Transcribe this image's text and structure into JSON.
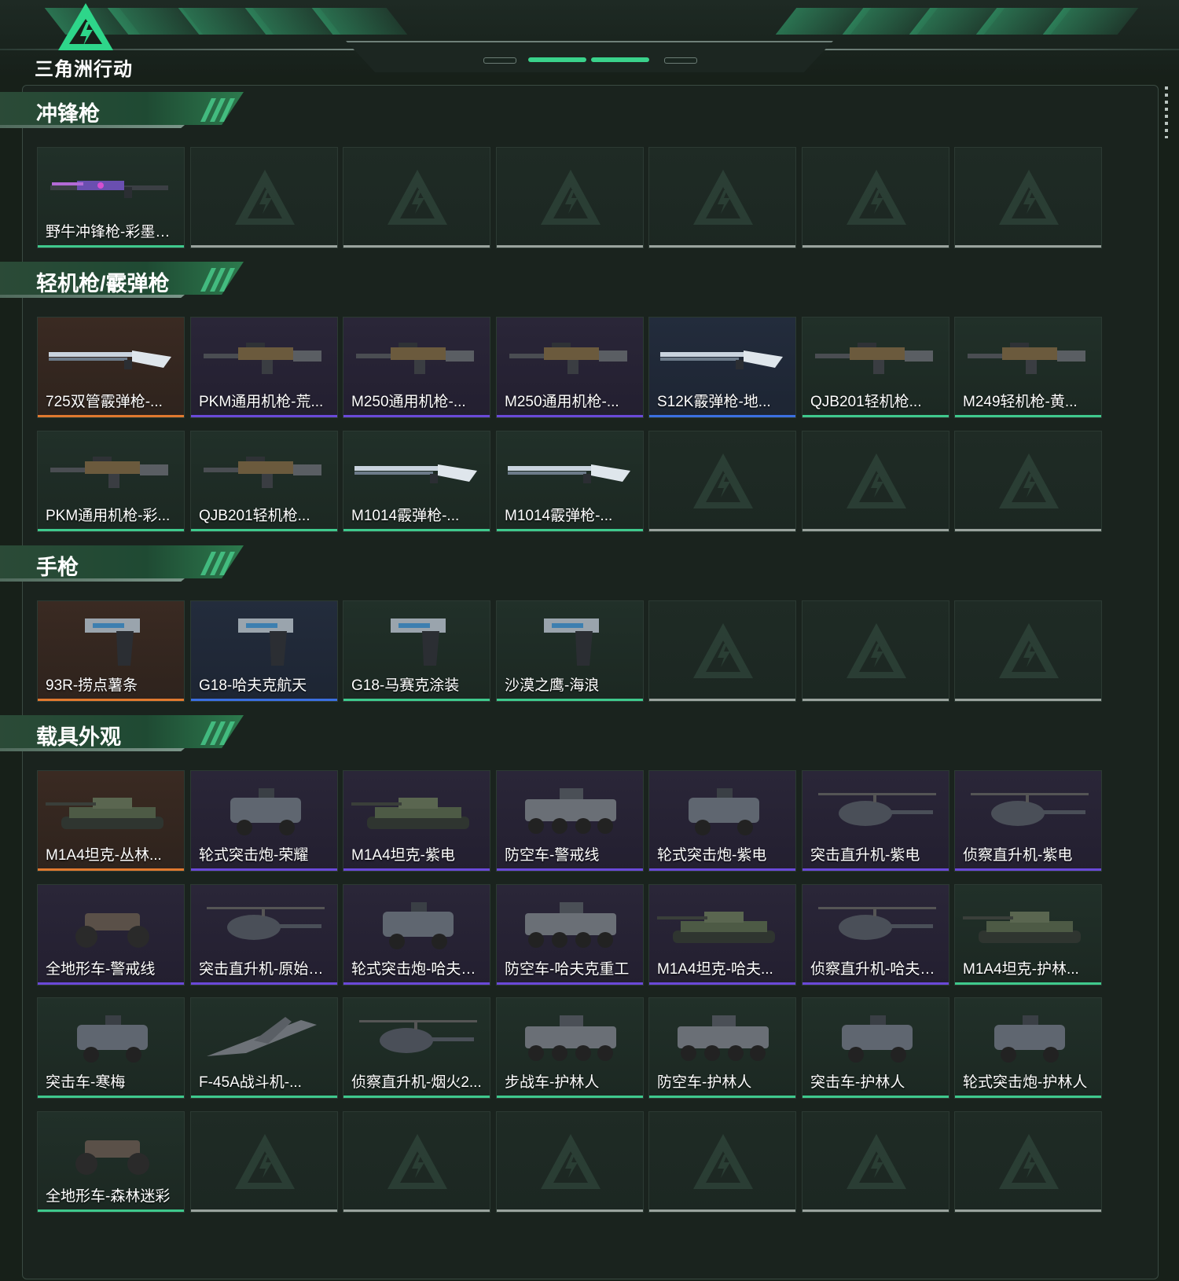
{
  "brand": {
    "logo_text": "三角洲行动"
  },
  "colors": {
    "accent": "#36c583",
    "rarity": {
      "orange": "#e0792f",
      "purple": "#6a49d8",
      "blue": "#3b6fe0",
      "green": "#3fc98d",
      "empty": "#9aa39e"
    }
  },
  "sections": [
    {
      "title": "冲锋枪",
      "items": [
        {
          "name": "野牛冲锋枪-彩墨喷...",
          "rarity": "green",
          "icon": "smg-icon"
        },
        null,
        null,
        null,
        null,
        null,
        null
      ]
    },
    {
      "title": "轻机枪/霰弹枪",
      "items": [
        {
          "name": "725双管霰弹枪-...",
          "rarity": "orange",
          "icon": "shotgun-icon"
        },
        {
          "name": "PKM通用机枪-荒...",
          "rarity": "purple",
          "icon": "machine-gun-icon"
        },
        {
          "name": "M250通用机枪-...",
          "rarity": "purple",
          "icon": "machine-gun-icon"
        },
        {
          "name": "M250通用机枪-...",
          "rarity": "purple",
          "icon": "machine-gun-icon"
        },
        {
          "name": "S12K霰弹枪-地...",
          "rarity": "blue",
          "icon": "shotgun-icon"
        },
        {
          "name": "QJB201轻机枪...",
          "rarity": "green",
          "icon": "machine-gun-icon"
        },
        {
          "name": "M249轻机枪-黄...",
          "rarity": "green",
          "icon": "machine-gun-icon"
        },
        {
          "name": "PKM通用机枪-彩...",
          "rarity": "green",
          "icon": "machine-gun-icon"
        },
        {
          "name": "QJB201轻机枪...",
          "rarity": "green",
          "icon": "machine-gun-icon"
        },
        {
          "name": "M1014霰弹枪-...",
          "rarity": "green",
          "icon": "shotgun-icon"
        },
        {
          "name": "M1014霰弹枪-...",
          "rarity": "green",
          "icon": "shotgun-icon"
        },
        null,
        null,
        null
      ]
    },
    {
      "title": "手枪",
      "items": [
        {
          "name": "93R-捞点薯条",
          "rarity": "orange",
          "icon": "pistol-icon"
        },
        {
          "name": "G18-哈夫克航天",
          "rarity": "blue",
          "icon": "pistol-icon"
        },
        {
          "name": "G18-马赛克涂装",
          "rarity": "green",
          "icon": "pistol-icon"
        },
        {
          "name": "沙漠之鹰-海浪",
          "rarity": "green",
          "icon": "pistol-icon"
        },
        null,
        null,
        null
      ]
    },
    {
      "title": "载具外观",
      "items": [
        {
          "name": "M1A4坦克-丛林...",
          "rarity": "orange",
          "icon": "tank-icon"
        },
        {
          "name": "轮式突击炮-荣耀",
          "rarity": "purple",
          "icon": "armored-car-icon"
        },
        {
          "name": "M1A4坦克-紫电",
          "rarity": "purple",
          "icon": "tank-icon"
        },
        {
          "name": "防空车-警戒线",
          "rarity": "purple",
          "icon": "apc-icon"
        },
        {
          "name": "轮式突击炮-紫电",
          "rarity": "purple",
          "icon": "armored-car-icon"
        },
        {
          "name": "突击直升机-紫电",
          "rarity": "purple",
          "icon": "helicopter-icon"
        },
        {
          "name": "侦察直升机-紫电",
          "rarity": "purple",
          "icon": "helicopter-icon"
        },
        {
          "name": "全地形车-警戒线",
          "rarity": "purple",
          "icon": "atv-icon"
        },
        {
          "name": "突击直升机-原始伪...",
          "rarity": "purple",
          "icon": "helicopter-icon"
        },
        {
          "name": "轮式突击炮-哈夫克...",
          "rarity": "purple",
          "icon": "armored-car-icon"
        },
        {
          "name": "防空车-哈夫克重工",
          "rarity": "purple",
          "icon": "apc-icon"
        },
        {
          "name": "M1A4坦克-哈夫...",
          "rarity": "purple",
          "icon": "tank-icon"
        },
        {
          "name": "侦察直升机-哈夫克...",
          "rarity": "purple",
          "icon": "helicopter-icon"
        },
        {
          "name": "M1A4坦克-护林...",
          "rarity": "green",
          "icon": "tank-icon"
        },
        {
          "name": "突击车-寒梅",
          "rarity": "green",
          "icon": "armored-car-icon"
        },
        {
          "name": "F-45A战斗机-...",
          "rarity": "green",
          "icon": "jet-icon"
        },
        {
          "name": "侦察直升机-烟火2...",
          "rarity": "green",
          "icon": "helicopter-icon"
        },
        {
          "name": "步战车-护林人",
          "rarity": "green",
          "icon": "apc-icon"
        },
        {
          "name": "防空车-护林人",
          "rarity": "green",
          "icon": "apc-icon"
        },
        {
          "name": "突击车-护林人",
          "rarity": "green",
          "icon": "armored-car-icon"
        },
        {
          "name": "轮式突击炮-护林人",
          "rarity": "green",
          "icon": "armored-car-icon"
        },
        {
          "name": "全地形车-森林迷彩",
          "rarity": "green",
          "icon": "atv-icon"
        },
        null,
        null,
        null,
        null,
        null,
        null
      ]
    }
  ]
}
